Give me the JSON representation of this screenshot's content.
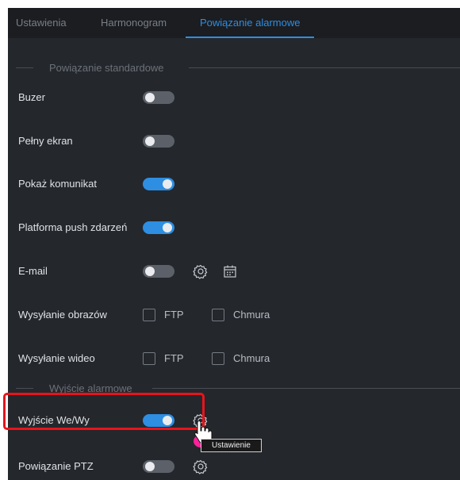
{
  "tabs": [
    {
      "label": "Ustawienia",
      "active": false
    },
    {
      "label": "Harmonogram",
      "active": false
    },
    {
      "label": "Powiązanie alarmowe",
      "active": true
    }
  ],
  "sections": {
    "standard": {
      "title": "Powiązanie standardowe"
    },
    "output": {
      "title": "Wyjście alarmowe"
    }
  },
  "rows": {
    "buzzer": {
      "label": "Buzer",
      "enabled": false
    },
    "fullscreen": {
      "label": "Pełny ekran",
      "enabled": false
    },
    "message": {
      "label": "Pokaż komunikat",
      "enabled": true
    },
    "push": {
      "label": "Platforma push zdarzeń",
      "enabled": true
    },
    "email": {
      "label": "E-mail",
      "enabled": false,
      "icons": [
        "gear-icon",
        "calendar-icon"
      ]
    },
    "image_upload": {
      "label": "Wysyłanie obrazów",
      "options": [
        {
          "label": "FTP",
          "checked": false
        },
        {
          "label": "Chmura",
          "checked": false
        }
      ]
    },
    "video_upload": {
      "label": "Wysyłanie wideo",
      "options": [
        {
          "label": "FTP",
          "checked": false
        },
        {
          "label": "Chmura",
          "checked": false
        }
      ]
    },
    "io_output": {
      "label": "Wyjście We/Wy",
      "enabled": true,
      "icons": [
        "gear-icon"
      ]
    },
    "ptz": {
      "label": "Powiązanie PTZ",
      "enabled": false,
      "icons": [
        "gear-icon"
      ]
    }
  },
  "tooltip": {
    "text": "Ustawienie"
  },
  "colors": {
    "accent": "#2d8ee2",
    "highlight": "#e8141c",
    "background": "#24272c",
    "tab_bar": "#1b1d21"
  }
}
